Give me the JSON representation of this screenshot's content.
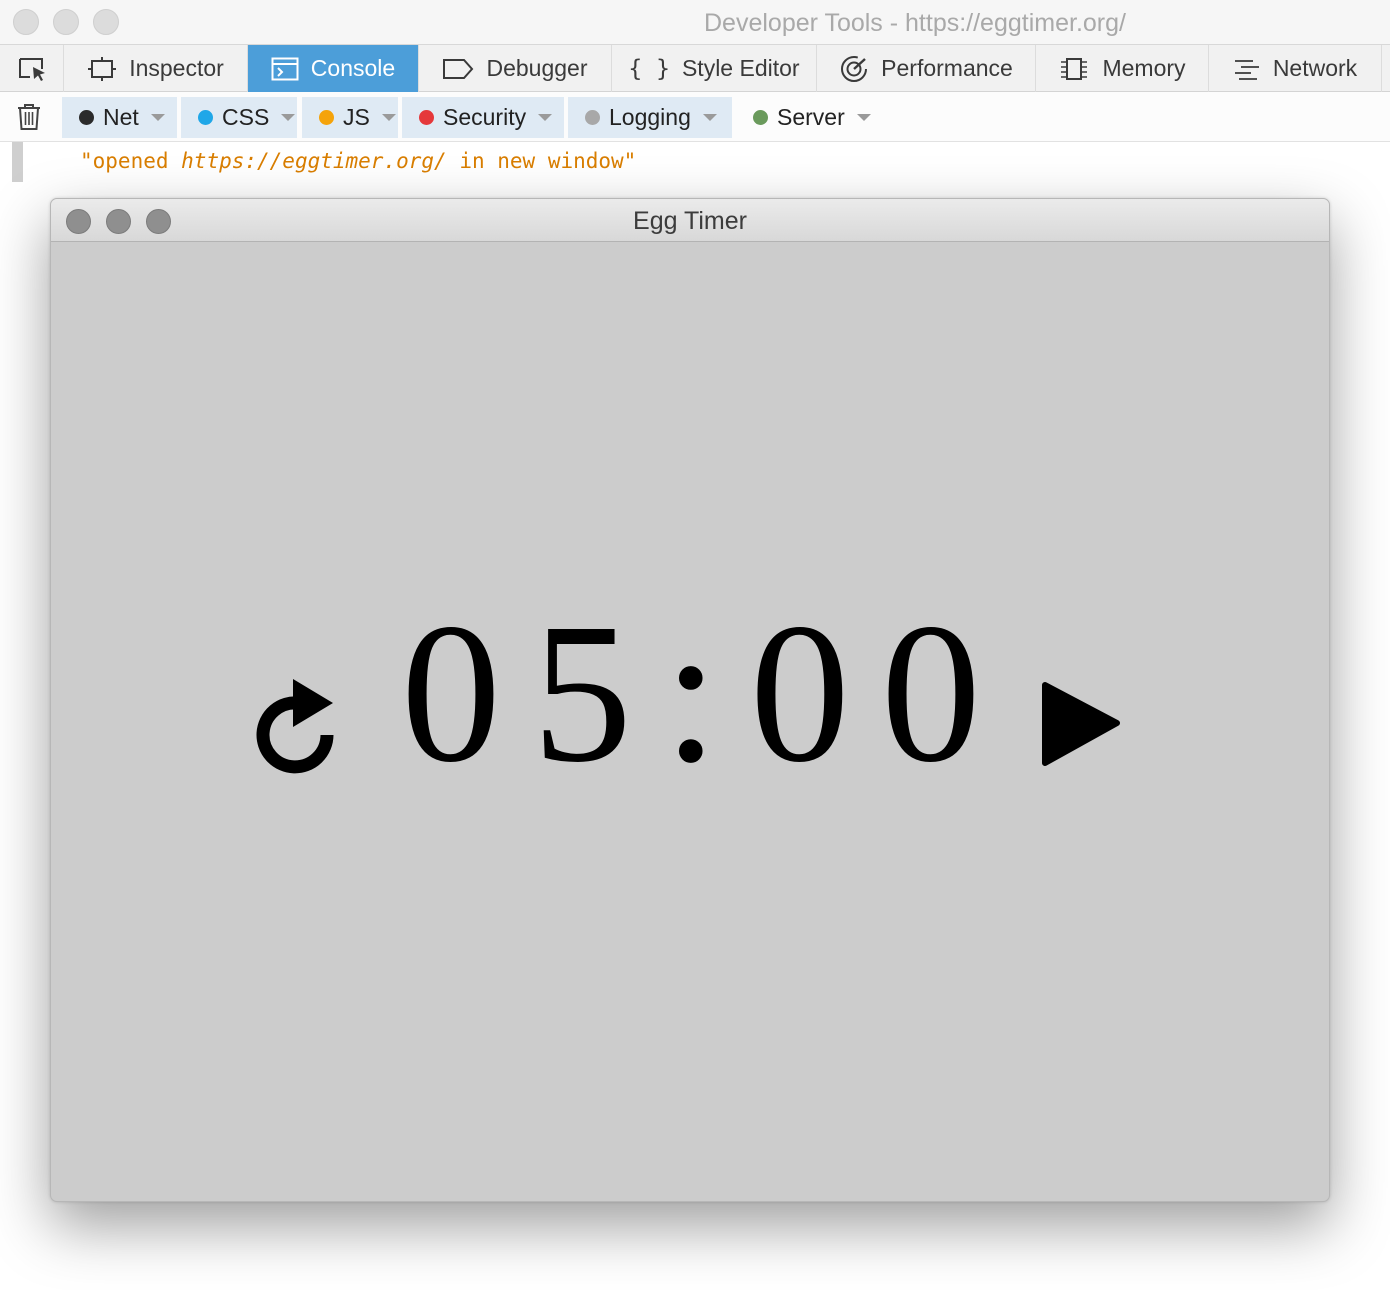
{
  "window": {
    "title": "Developer Tools - https://eggtimer.org/"
  },
  "toolbar": {
    "picker_icon": "element-picker-icon",
    "tabs": [
      {
        "label": "Inspector",
        "icon": "inspector-icon"
      },
      {
        "label": "Console",
        "icon": "console-icon",
        "active": true
      },
      {
        "label": "Debugger",
        "icon": "debugger-icon"
      },
      {
        "label": "Style Editor",
        "icon": "braces-icon",
        "icon_text": "{ }"
      },
      {
        "label": "Performance",
        "icon": "performance-icon"
      },
      {
        "label": "Memory",
        "icon": "memory-icon"
      },
      {
        "label": "Network",
        "icon": "network-icon"
      }
    ],
    "active_color": "#4c9ed9"
  },
  "filters": {
    "clear_icon": "trash-icon",
    "items": [
      {
        "label": "Net",
        "color": "#2b2b2b",
        "enabled": true
      },
      {
        "label": "CSS",
        "color": "#1fa7e8",
        "enabled": true
      },
      {
        "label": "JS",
        "color": "#f5a30a",
        "enabled": true
      },
      {
        "label": "Security",
        "color": "#e5383b",
        "enabled": true
      },
      {
        "label": "Logging",
        "color": "#a8a8a8",
        "enabled": true
      },
      {
        "label": "Server",
        "color": "#6a9a5c",
        "enabled": false
      }
    ]
  },
  "console": {
    "log": {
      "open_quote": "\"opened ",
      "url": "https://eggtimer.org/",
      "close": " in new window\""
    },
    "text_color": "#d97e00"
  },
  "egg_timer": {
    "title": "Egg Timer",
    "time": {
      "d1": "0",
      "d2": "5",
      "sep": ":",
      "d3": "0",
      "d4": "0"
    },
    "reset_icon": "reset-icon",
    "play_icon": "play-icon",
    "background": "#cccccc"
  }
}
